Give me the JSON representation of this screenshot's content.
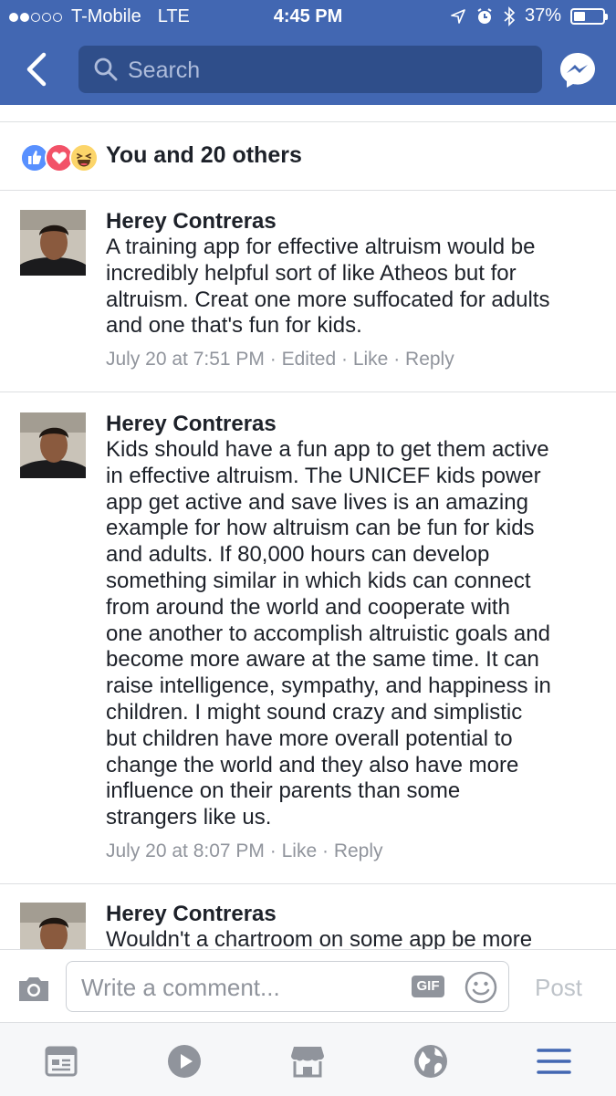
{
  "status_bar": {
    "carrier": "T-Mobile",
    "network": "LTE",
    "time": "4:45 PM",
    "battery": "37%"
  },
  "nav": {
    "search_placeholder": "Search"
  },
  "reactions": {
    "summary": "You and 20 others"
  },
  "comments": [
    {
      "author": "Herey Contreras",
      "lines": [
        "A training app for effective altruism would be",
        "incredibly helpful sort of like Atheos but for",
        "altruism. Creat one more suffocated for adults",
        "and one that's fun for kids."
      ],
      "timestamp": "July 20 at 7:51 PM",
      "edited": "Edited",
      "like": "Like",
      "reply": "Reply"
    },
    {
      "author": "Herey Contreras",
      "lines": [
        "Kids should have a fun app to get them active",
        "in effective altruism. The UNICEF kids power",
        "app get active and save lives is an amazing",
        "example for how altruism can be fun for kids",
        "and adults. If 80,000 hours can develop",
        "something similar in which kids can connect",
        "from around the world and cooperate with",
        "one another to accomplish altruistic goals and",
        "become more aware at the same time. It can",
        "raise intelligence, sympathy, and happiness in",
        "children. I might sound crazy and simplistic",
        "but children have more overall potential to",
        "change the world and they also have more",
        "influence on their parents than some",
        "strangers like us."
      ],
      "timestamp": "July 20 at 8:07 PM",
      "like": "Like",
      "reply": "Reply"
    },
    {
      "author": "Herey Contreras",
      "lines": [
        "Wouldn't a chartroom on some app be more"
      ]
    }
  ],
  "composer": {
    "placeholder": "Write a comment...",
    "gif_label": "GIF",
    "post_label": "Post"
  },
  "colors": {
    "brand_blue": "#4267b2",
    "search_bg": "#2f4e8a",
    "meta_gray": "#90949c"
  },
  "tabs": [
    "news-feed-icon",
    "video-icon",
    "marketplace-icon",
    "notifications-globe-icon",
    "menu-icon"
  ]
}
